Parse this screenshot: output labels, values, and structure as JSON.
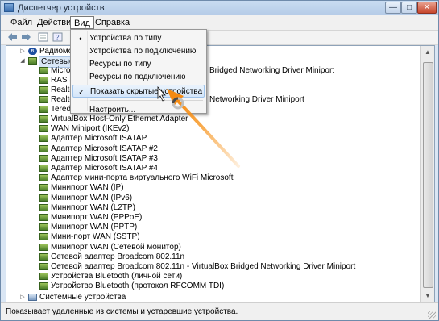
{
  "window": {
    "title": "Диспетчер устройств",
    "buttons": {
      "minimize": "—",
      "maximize": "□",
      "close": "✕"
    }
  },
  "menubar": {
    "file": "Файл",
    "action": "Действие",
    "view": "Вид",
    "help": "Справка"
  },
  "toolbar": {
    "icons": [
      "back-icon",
      "forward-icon",
      "properties-icon",
      "help-icon",
      "device-icon"
    ]
  },
  "view_menu": {
    "items": [
      {
        "label": "Устройства по типу",
        "mark": "•"
      },
      {
        "label": "Устройства по подключению",
        "mark": ""
      },
      {
        "label": "Ресурсы по типу",
        "mark": ""
      },
      {
        "label": "Ресурсы по подключению",
        "mark": ""
      },
      {
        "label": "Показать скрытые устройства",
        "mark": "✓"
      },
      {
        "label": "Настроить...",
        "mark": ""
      }
    ],
    "highlighted_index": 4
  },
  "tree": {
    "categories": {
      "radio": "Радиомо",
      "network": "Сетевые",
      "system": "Системные устройства"
    },
    "partial_rows": [
      {
        "left": "Micro",
        "right": "Bridged Networking Driver Miniport"
      },
      {
        "left": "RAS a",
        "right": ""
      },
      {
        "left": "Realte",
        "right": ""
      },
      {
        "left": "Realte",
        "right": "Networking Driver Miniport"
      },
      {
        "left": "Tered",
        "right": ""
      }
    ],
    "devices": [
      "VirtualBox Host-Only Ethernet Adapter",
      "WAN Miniport (IKEv2)",
      "Адаптер Microsoft ISATAP",
      "Адаптер Microsoft ISATAP #2",
      "Адаптер Microsoft ISATAP #3",
      "Адаптер Microsoft ISATAP #4",
      "Адаптер мини-порта виртуального WiFi Microsoft",
      "Минипорт WAN (IP)",
      "Минипорт WAN (IPv6)",
      "Минипорт WAN (L2TP)",
      "Минипорт WAN (PPPoE)",
      "Минипорт WAN (PPTP)",
      "Мини-порт WAN (SSTP)",
      "Минипорт WAN (Сетевой монитор)",
      "Сетевой адаптер Broadcom 802.11n",
      "Сетевой адаптер Broadcom 802.11n - VirtualBox Bridged Networking Driver Miniport",
      "Устройства Bluetooth (личной сети)",
      "Устройство Bluetooth (протокол RFCOMM TDI)"
    ]
  },
  "statusbar": {
    "text": "Показывает удаленные из системы и устаревшие устройства."
  },
  "colors": {
    "arrow": "#f7941d",
    "menu_highlight": "#d4e6fa",
    "titlebar": "#b4cbe7"
  }
}
